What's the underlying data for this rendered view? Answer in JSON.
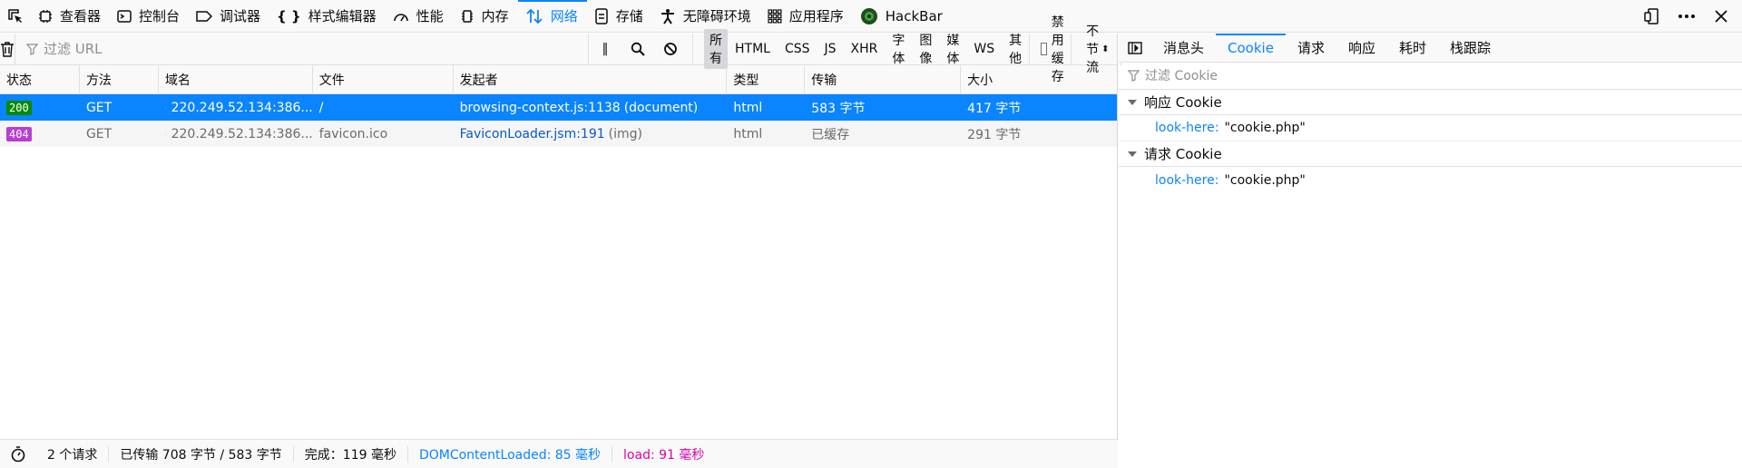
{
  "toolbar": {
    "tabs": [
      {
        "label": "查看器",
        "icon": "inspector-icon"
      },
      {
        "label": "控制台",
        "icon": "console-icon"
      },
      {
        "label": "调试器",
        "icon": "debugger-icon"
      },
      {
        "label": "样式编辑器",
        "icon": "style-editor-icon"
      },
      {
        "label": "性能",
        "icon": "performance-icon"
      },
      {
        "label": "内存",
        "icon": "memory-icon"
      },
      {
        "label": "网络",
        "icon": "network-icon",
        "active": true
      },
      {
        "label": "存储",
        "icon": "storage-icon"
      },
      {
        "label": "无障碍环境",
        "icon": "accessibility-icon"
      },
      {
        "label": "应用程序",
        "icon": "application-icon"
      },
      {
        "label": "HackBar",
        "icon": "hackbar-icon"
      }
    ],
    "accent": "#0a84ff"
  },
  "filter": {
    "placeholder": "过滤 URL",
    "pause_label": "‖",
    "types": [
      "所有",
      "HTML",
      "CSS",
      "JS",
      "XHR",
      "字体",
      "图像",
      "媒体",
      "WS",
      "其他"
    ],
    "disable_cache_label": "禁用缓存",
    "throttle_label": "不节流"
  },
  "table": {
    "headers": [
      "状态",
      "方法",
      "域名",
      "文件",
      "发起者",
      "类型",
      "传输",
      "大小"
    ],
    "rows": [
      {
        "status": "200",
        "method": "GET",
        "domain": "220.249.52.134:386...",
        "file": "/",
        "initiator": "browsing-context.js:1138",
        "initiator_extra": "(document)",
        "type": "html",
        "transferred": "583 字节",
        "size": "417 字节"
      },
      {
        "status": "404",
        "method": "GET",
        "domain": "220.249.52.134:386...",
        "file": "favicon.ico",
        "initiator": "FaviconLoader.jsm:191",
        "initiator_extra": "(img)",
        "type": "html",
        "transferred": "已缓存",
        "size": "291 字节"
      }
    ]
  },
  "statusbar": {
    "requests": "2 个请求",
    "transferred": "已传输 708 字节 / 583 字节",
    "finish": "完成：119 毫秒",
    "dcl": "DOMContentLoaded: 85 毫秒",
    "load": "load: 91 毫秒"
  },
  "details": {
    "tabs": [
      "消息头",
      "Cookie",
      "请求",
      "响应",
      "耗时",
      "栈跟踪"
    ],
    "active_tab": "Cookie",
    "filter_placeholder": "过滤 Cookie",
    "response_cookie_title": "响应 Cookie",
    "request_cookie_title": "请求 Cookie",
    "response_cookie": {
      "name": "look-here:",
      "value": "\"cookie.php\""
    },
    "request_cookie": {
      "name": "look-here:",
      "value": "\"cookie.php\""
    }
  }
}
